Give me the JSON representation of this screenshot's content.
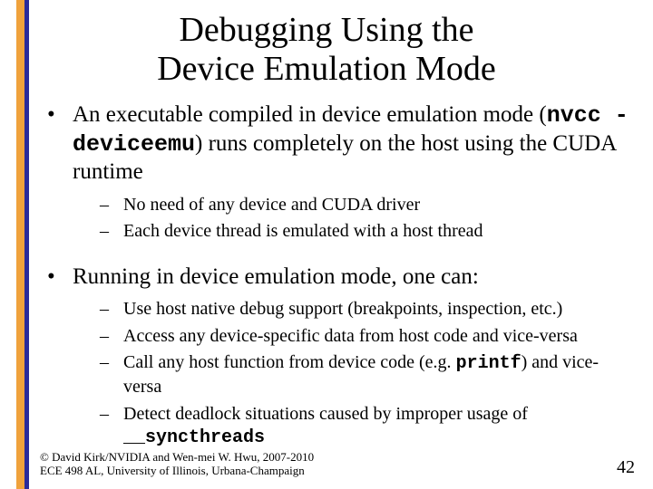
{
  "title_line1": "Debugging Using the",
  "title_line2": "Device Emulation Mode",
  "bullets": [
    {
      "segments": [
        {
          "t": "An executable compiled in device emulation mode ("
        },
        {
          "t": "nvcc -deviceemu",
          "mono": true,
          "bold": true
        },
        {
          "t": ") runs completely on the host using the CUDA runtime"
        }
      ],
      "sub": [
        {
          "segments": [
            {
              "t": "No need of any device and CUDA driver"
            }
          ]
        },
        {
          "segments": [
            {
              "t": "Each device thread is emulated with a host thread"
            }
          ]
        }
      ]
    },
    {
      "segments": [
        {
          "t": "Running in device emulation mode, one can:"
        }
      ],
      "sub": [
        {
          "segments": [
            {
              "t": "Use host native debug support (breakpoints, inspection, etc.)"
            }
          ]
        },
        {
          "segments": [
            {
              "t": "Access any device-specific data from host code and vice-versa"
            }
          ]
        },
        {
          "segments": [
            {
              "t": "Call any host function from device code (e.g. "
            },
            {
              "t": "printf",
              "mono": true,
              "bold": true
            },
            {
              "t": ") and vice-versa"
            }
          ]
        },
        {
          "segments": [
            {
              "t": "Detect deadlock situations caused by improper usage of "
            },
            {
              "t": "__syncthreads",
              "mono": true,
              "bold": true
            }
          ]
        }
      ]
    }
  ],
  "footer_line1": "© David Kirk/NVIDIA and Wen-mei W. Hwu, 2007-2010",
  "footer_line2": "ECE 498 AL, University of Illinois, Urbana-Champaign",
  "page_number": "42"
}
